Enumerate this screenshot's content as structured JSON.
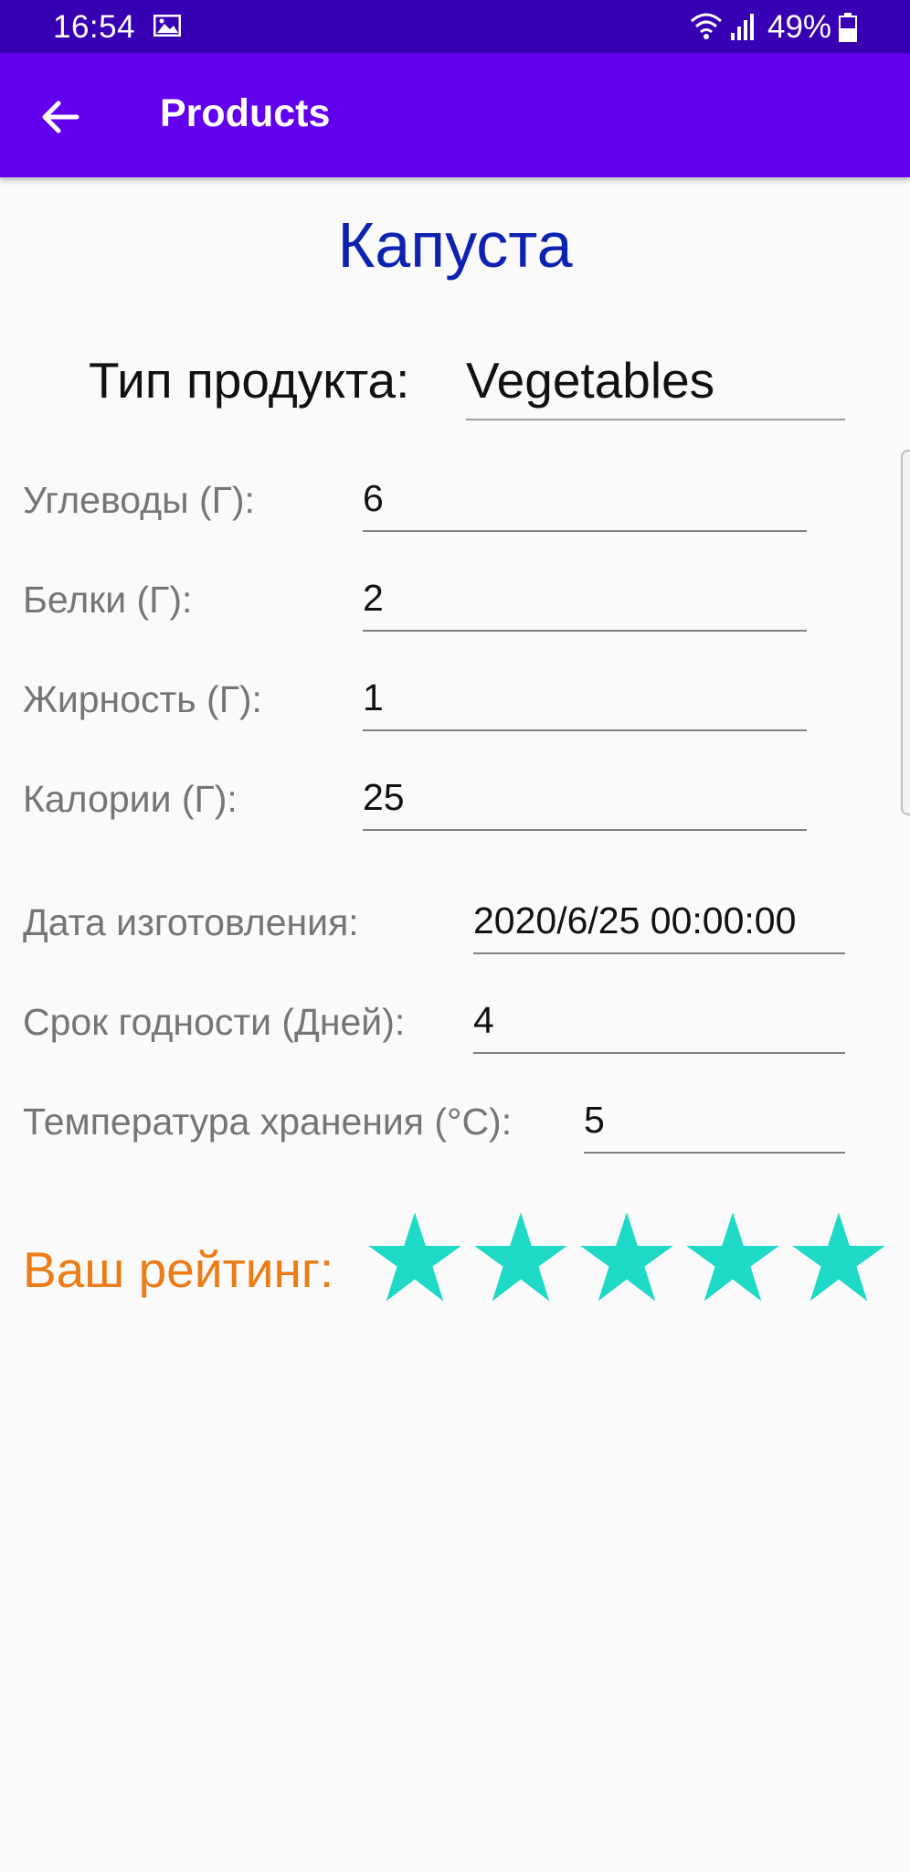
{
  "status_bar": {
    "time": "16:54",
    "battery": "49%",
    "icons": [
      "image-icon",
      "wifi-icon",
      "signal-icon",
      "battery-icon"
    ]
  },
  "app_bar": {
    "title": "Products",
    "back_icon": "arrow-back-icon",
    "background": "#6200ee",
    "status_background": "#3700b3"
  },
  "product": {
    "name": "Капуста",
    "type_label": "Тип продукта:",
    "type_value": "Vegetables"
  },
  "nutrition": [
    {
      "label": "Углеводы (Г):",
      "value": "6"
    },
    {
      "label": "Белки (Г):",
      "value": "2"
    },
    {
      "label": "Жирность (Г):",
      "value": "1"
    },
    {
      "label": "Калории (Г):",
      "value": "25"
    }
  ],
  "storage": [
    {
      "label": "Дата изготовления:",
      "value": "2020/6/25 00:00:00"
    },
    {
      "label": "Срок годности (Дней):",
      "value": "4"
    },
    {
      "label": "Температура хранения (°C):",
      "value": "5"
    }
  ],
  "rating": {
    "label": "Ваш рейтинг:",
    "value": 5,
    "max": 5,
    "star_color": "#1dd9c6",
    "label_color": "#ec7c16"
  },
  "colors": {
    "product_name": "#0d23b0"
  }
}
